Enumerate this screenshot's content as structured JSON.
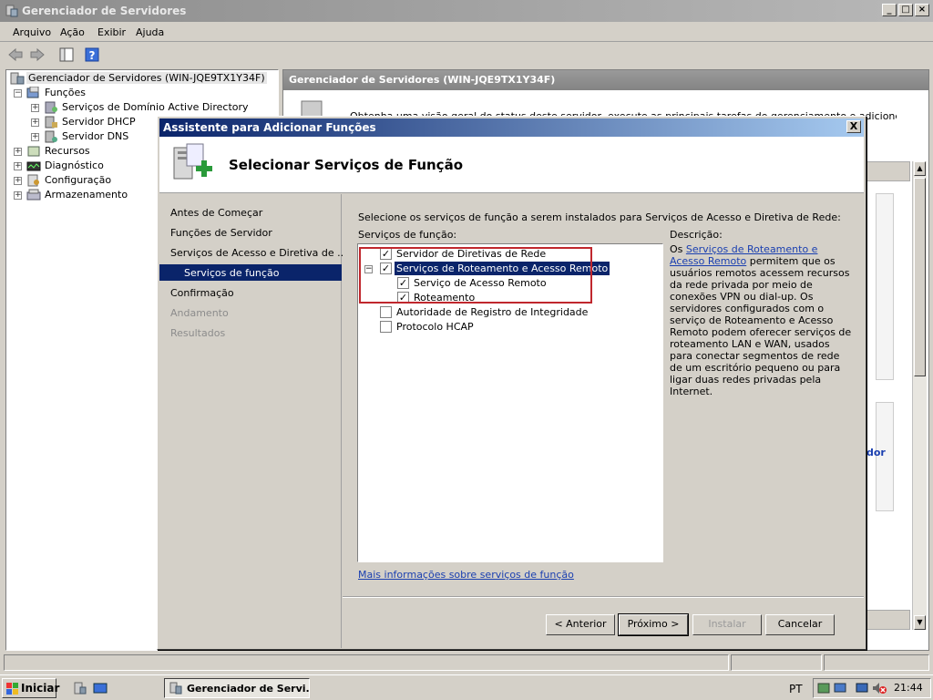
{
  "window": {
    "title": "Gerenciador de Servidores"
  },
  "menu": [
    "Arquivo",
    "Ação",
    "Exibir",
    "Ajuda"
  ],
  "tree": {
    "root": "Gerenciador de Servidores (WIN-JQE9TX1Y34F)",
    "funcoes": "Funções",
    "children": [
      "Serviços de Domínio Active Directory",
      "Servidor DHCP",
      "Servidor DNS"
    ],
    "others": [
      "Recursos",
      "Diagnóstico",
      "Configuração",
      "Armazenamento"
    ]
  },
  "right": {
    "header": "Gerenciador de Servidores (WIN-JQE9TX1Y34F)",
    "partial_text": "Obtenha uma visão geral do status deste servidor, execute as principais tarefas de gerenciamento e adicione ou remova",
    "partial_right": "dor"
  },
  "dialog": {
    "title": "Assistente para Adicionar Funções",
    "close": "X",
    "heading": "Selecionar Serviços de Função",
    "steps": [
      {
        "label": "Antes de Começar",
        "state": "normal"
      },
      {
        "label": "Funções de Servidor",
        "state": "normal"
      },
      {
        "label": "Serviços de Acesso e Diretiva de ...",
        "state": "normal"
      },
      {
        "label": "Serviços de função",
        "state": "current"
      },
      {
        "label": "Confirmação",
        "state": "normal"
      },
      {
        "label": "Andamento",
        "state": "disabled"
      },
      {
        "label": "Resultados",
        "state": "disabled"
      }
    ],
    "instruction": "Selecione os serviços de função a serem instalados para Serviços de Acesso e Diretiva de Rede:",
    "services_label": "Serviços de função:",
    "description_label": "Descrição:",
    "services": [
      {
        "label": "Servidor de Diretivas de Rede",
        "checked": true
      },
      {
        "label": "Serviços de Roteamento e Acesso Remoto",
        "checked": true
      },
      {
        "label": "Serviço de Acesso Remoto",
        "checked": true
      },
      {
        "label": "Roteamento",
        "checked": true
      },
      {
        "label": "Autoridade de Registro de Integridade",
        "checked": false
      },
      {
        "label": "Protocolo HCAP",
        "checked": false
      }
    ],
    "description": {
      "prefix": "Os ",
      "link": "Serviços de Roteamento e Acesso Remoto",
      "body": " permitem que os usuários remotos acessem recursos da rede privada por meio de conexões VPN ou dial-up. Os servidores configurados com o serviço de Roteamento e Acesso Remoto podem oferecer serviços de roteamento LAN e WAN, usados para conectar segmentos de rede de um escritório pequeno ou para ligar duas redes privadas pela Internet."
    },
    "more_link": "Mais informações sobre serviços de função",
    "buttons": {
      "back": "< Anterior",
      "next": "Próximo >",
      "install": "Instalar",
      "cancel": "Cancelar"
    }
  },
  "taskbar": {
    "start": "Iniciar",
    "task": "Gerenciador de Servi...",
    "lang": "PT",
    "clock": "21:44"
  }
}
